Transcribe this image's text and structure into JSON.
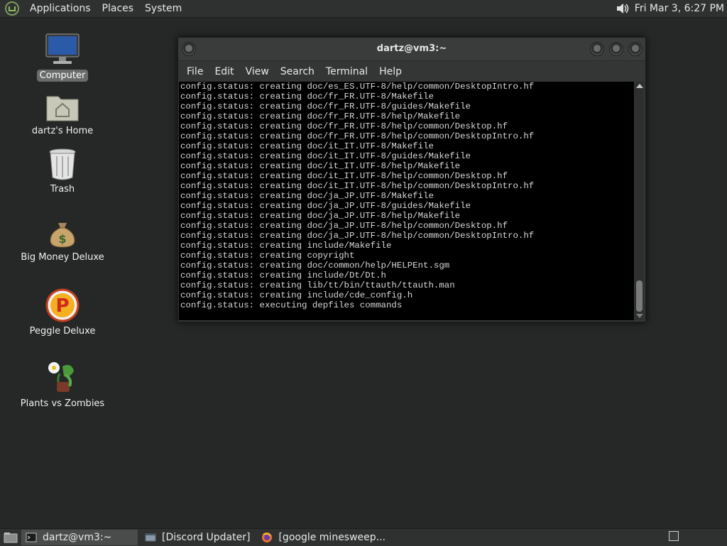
{
  "top_panel": {
    "menus": [
      "Applications",
      "Places",
      "System"
    ],
    "clock": "Fri Mar 3, 6:27 PM"
  },
  "desktop_icons": [
    {
      "label": "Computer",
      "icon": "computer-icon"
    },
    {
      "label": "dartz's Home",
      "icon": "home-folder-icon"
    },
    {
      "label": "Trash",
      "icon": "trash-icon"
    },
    {
      "label": "Big Money Deluxe",
      "icon": "money-bag-icon"
    },
    {
      "label": "Peggle Deluxe",
      "icon": "peggle-icon"
    },
    {
      "label": "Plants vs Zombies",
      "icon": "plants-vs-zombies-icon"
    }
  ],
  "terminal": {
    "title": "dartz@vm3:~",
    "menu": [
      "File",
      "Edit",
      "View",
      "Search",
      "Terminal",
      "Help"
    ],
    "lines": [
      "config.status: creating doc/es_ES.UTF-8/help/common/DesktopIntro.hf",
      "config.status: creating doc/fr_FR.UTF-8/Makefile",
      "config.status: creating doc/fr_FR.UTF-8/guides/Makefile",
      "config.status: creating doc/fr_FR.UTF-8/help/Makefile",
      "config.status: creating doc/fr_FR.UTF-8/help/common/Desktop.hf",
      "config.status: creating doc/fr_FR.UTF-8/help/common/DesktopIntro.hf",
      "config.status: creating doc/it_IT.UTF-8/Makefile",
      "config.status: creating doc/it_IT.UTF-8/guides/Makefile",
      "config.status: creating doc/it_IT.UTF-8/help/Makefile",
      "config.status: creating doc/it_IT.UTF-8/help/common/Desktop.hf",
      "config.status: creating doc/it_IT.UTF-8/help/common/DesktopIntro.hf",
      "config.status: creating doc/ja_JP.UTF-8/Makefile",
      "config.status: creating doc/ja_JP.UTF-8/guides/Makefile",
      "config.status: creating doc/ja_JP.UTF-8/help/Makefile",
      "config.status: creating doc/ja_JP.UTF-8/help/common/Desktop.hf",
      "config.status: creating doc/ja_JP.UTF-8/help/common/DesktopIntro.hf",
      "config.status: creating include/Makefile",
      "config.status: creating copyright",
      "config.status: creating doc/common/help/HELPEnt.sgm",
      "config.status: creating include/Dt/Dt.h",
      "config.status: creating lib/tt/bin/ttauth/ttauth.man",
      "config.status: creating include/cde_config.h",
      "config.status: executing depfiles commands"
    ]
  },
  "taskbar": {
    "tasks": [
      {
        "label": "dartz@vm3:~",
        "active": true,
        "icon": "terminal-icon"
      },
      {
        "label": "[Discord Updater]",
        "active": false,
        "icon": "window-icon"
      },
      {
        "label": "[google minesweep...",
        "active": false,
        "icon": "firefox-icon"
      }
    ]
  },
  "colors": {
    "desktop": "#262828",
    "panel": "#2f3131",
    "terminal_bg": "#000000",
    "terminal_fg": "#d8d8d8"
  }
}
